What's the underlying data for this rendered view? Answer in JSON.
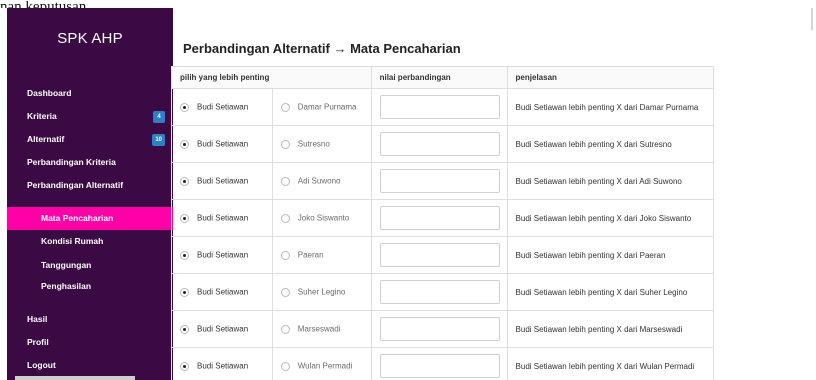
{
  "top_snippet": "nan keputusan.",
  "brand": "SPK AHP",
  "nav": {
    "dashboard": "Dashboard",
    "kriteria": "Kriteria",
    "kriteria_badge": "4",
    "alternatif": "Alternatif",
    "alternatif_badge": "10",
    "perbandingan_kriteria": "Perbandingan Kriteria",
    "perbandingan_alternatif": "Perbandingan Alternatif",
    "subs": [
      "Mata Pencaharian",
      "Kondisi Rumah",
      "Tanggungan",
      "Penghasilan"
    ],
    "hasil": "Hasil",
    "profil": "Profil",
    "logout": "Logout"
  },
  "title": "Perbandingan Alternatif → Mata Pencaharian",
  "table": {
    "headers": [
      "pilih yang lebih penting",
      "nilai perbandingan",
      "penjelasan"
    ],
    "rows": [
      {
        "left": "Budi Setiawan",
        "right": "Damar Purnama",
        "value": "",
        "note": "Budi Setiawan lebih penting X dari Damar Purnama"
      },
      {
        "left": "Budi Setiawan",
        "right": "Sutresno",
        "value": "",
        "note": "Budi Setiawan lebih penting X dari Sutresno"
      },
      {
        "left": "Budi Setiawan",
        "right": "Adi Suwono",
        "value": "",
        "note": "Budi Setiawan lebih penting X dari Adi Suwono"
      },
      {
        "left": "Budi Setiawan",
        "right": "Joko Siswanto",
        "value": "",
        "note": "Budi Setiawan lebih penting X dari Joko Siswanto"
      },
      {
        "left": "Budi Setiawan",
        "right": "Paeran",
        "value": "",
        "note": "Budi Setiawan lebih penting X dari Paeran"
      },
      {
        "left": "Budi Setiawan",
        "right": "Suher Legino",
        "value": "",
        "note": "Budi Setiawan lebih penting X dari Suher Legino"
      },
      {
        "left": "Budi Setiawan",
        "right": "Marseswadi",
        "value": "",
        "note": "Budi Setiawan lebih penting X dari Marseswadi"
      },
      {
        "left": "Budi Setiawan",
        "right": "Wulan Permadi",
        "value": "",
        "note": "Budi Setiawan lebih penting X dari Wulan Permadi"
      }
    ]
  },
  "colors": {
    "sidebar_bg": "#3b0a45",
    "active_item": "#ff00a6",
    "badge": "#2f7fc8"
  }
}
